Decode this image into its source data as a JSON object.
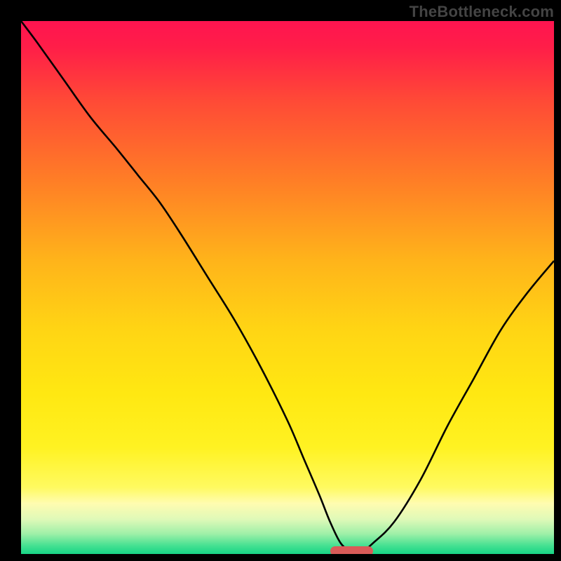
{
  "watermark": "TheBottleneck.com",
  "colors": {
    "frame": "#000000",
    "curve": "#000000",
    "marker": "#d95b58",
    "gradient_stops": [
      {
        "offset": 0.0,
        "color": "#ff1450"
      },
      {
        "offset": 0.05,
        "color": "#ff1e48"
      },
      {
        "offset": 0.15,
        "color": "#ff4a36"
      },
      {
        "offset": 0.3,
        "color": "#ff7e26"
      },
      {
        "offset": 0.45,
        "color": "#ffb41a"
      },
      {
        "offset": 0.58,
        "color": "#ffd514"
      },
      {
        "offset": 0.7,
        "color": "#ffe812"
      },
      {
        "offset": 0.8,
        "color": "#fff222"
      },
      {
        "offset": 0.875,
        "color": "#fffa60"
      },
      {
        "offset": 0.905,
        "color": "#fffcb0"
      },
      {
        "offset": 0.935,
        "color": "#dff9b8"
      },
      {
        "offset": 0.962,
        "color": "#9ff0a8"
      },
      {
        "offset": 0.985,
        "color": "#43e091"
      },
      {
        "offset": 1.0,
        "color": "#17d586"
      }
    ]
  },
  "chart_data": {
    "type": "line",
    "title": "",
    "xlabel": "",
    "ylabel": "",
    "xlim": [
      0,
      100
    ],
    "ylim": [
      0,
      100
    ],
    "grid": false,
    "series": [
      {
        "name": "bottleneck-curve",
        "x": [
          0,
          3,
          8,
          13,
          18,
          22,
          26,
          30,
          35,
          40,
          45,
          50,
          53,
          56,
          58,
          60,
          62,
          64,
          66,
          70,
          75,
          80,
          85,
          90,
          95,
          100
        ],
        "values": [
          100,
          96,
          89,
          82,
          76,
          71,
          66,
          60,
          52,
          44,
          35,
          25,
          18,
          11,
          6,
          2,
          0.5,
          0.5,
          2,
          6,
          14,
          24,
          33,
          42,
          49,
          55
        ]
      }
    ],
    "marker": {
      "x_start": 58,
      "x_end": 66,
      "y": 0.5
    },
    "annotations": []
  }
}
